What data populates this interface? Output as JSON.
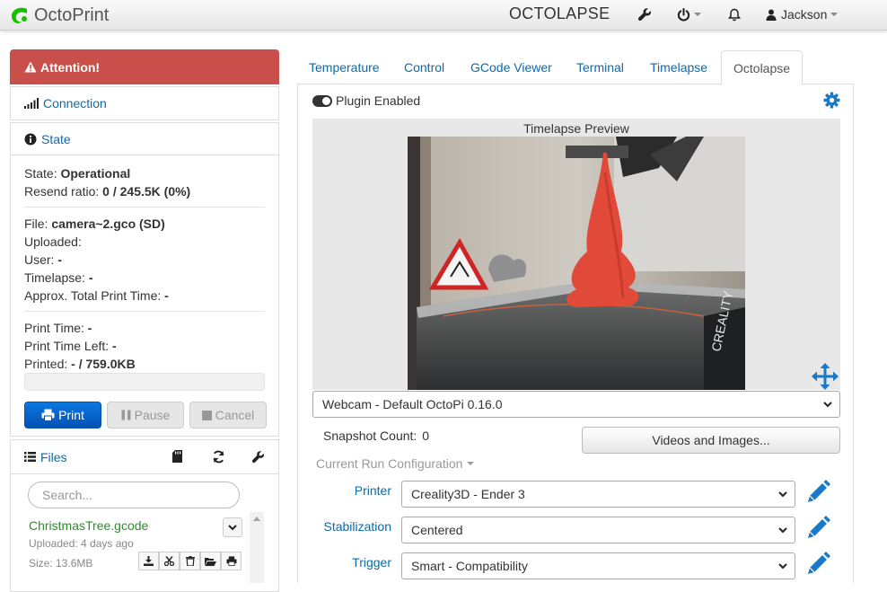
{
  "navbar": {
    "brand": "OctoPrint",
    "octolapse": "OCTOLAPSE",
    "user": "Jackson",
    "icons": [
      "settings-wrench-icon",
      "power-icon",
      "bell-icon",
      "user-icon"
    ]
  },
  "sidebar": {
    "attention": "Attention!",
    "connection": "Connection",
    "state": {
      "title": "State",
      "state_label": "State:",
      "state_value": "Operational",
      "resend_label": "Resend ratio:",
      "resend_value": "0 / 245.5K (0%)",
      "file_label": "File:",
      "file_value": "camera~2.gco (SD)",
      "uploaded_label": "Uploaded:",
      "user_label": "User:",
      "user_value": "-",
      "timelapse_label": "Timelapse:",
      "timelapse_value": "-",
      "approx_label": "Approx. Total Print Time:",
      "approx_value": "-",
      "print_time_label": "Print Time:",
      "print_time_value": "-",
      "print_left_label": "Print Time Left:",
      "print_left_value": "-",
      "printed_label": "Printed:",
      "printed_value": "- / 759.0KB",
      "progress": 0
    },
    "buttons": {
      "print": "Print",
      "pause": "Pause",
      "cancel": "Cancel"
    },
    "files": {
      "title": "Files",
      "search_placeholder": "Search...",
      "items": [
        {
          "name": "ChristmasTree.gcode",
          "uploaded": "Uploaded: 4 days ago",
          "size": "Size: 13.6MB"
        }
      ]
    }
  },
  "tabs": [
    "Temperature",
    "Control",
    "GCode Viewer",
    "Terminal",
    "Timelapse",
    "Octolapse"
  ],
  "active_tab": "Octolapse",
  "octolapse": {
    "plugin_enabled": "Plugin Enabled",
    "preview_title": "Timelapse Preview",
    "webcam": "Webcam - Default OctoPi 0.16.0",
    "snapshot_label": "Snapshot Count:",
    "snapshot_value": "0",
    "videos_button": "Videos and Images...",
    "current_run": "Current Run Configuration",
    "printer_label": "Printer",
    "printer_value": "Creality3D - Ender 3",
    "stabilization_label": "Stabilization",
    "stabilization_value": "Centered",
    "trigger_label": "Trigger",
    "trigger_value": "Smart - Compatibility"
  },
  "colors": {
    "link": "#0d6aa8",
    "attention": "#c9504a",
    "print_button": "#0662cc",
    "file_green": "#2e8b2e",
    "brand_green": "#13c100"
  }
}
